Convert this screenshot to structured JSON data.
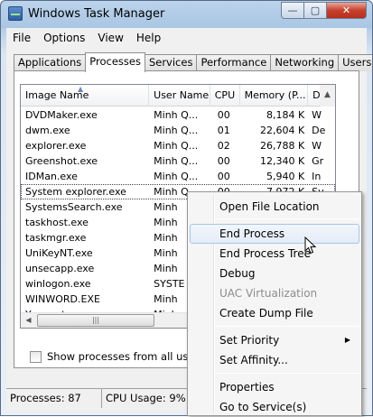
{
  "window": {
    "title": "Windows Task Manager",
    "min_label": "—",
    "max_label": "▢",
    "close_label": "✕"
  },
  "menu": [
    "File",
    "Options",
    "View",
    "Help"
  ],
  "tabs": [
    "Applications",
    "Processes",
    "Services",
    "Performance",
    "Networking",
    "Users"
  ],
  "active_tab": "Processes",
  "columns": [
    "Image Name",
    "User Name",
    "CPU",
    "Memory (P...",
    "De"
  ],
  "sort_arrow": "▲",
  "processes": [
    {
      "name": "DVDMaker.exe",
      "user": "Minh Q...",
      "cpu": "00",
      "mem": "8,184 K",
      "desc": "W"
    },
    {
      "name": "dwm.exe",
      "user": "Minh Q...",
      "cpu": "01",
      "mem": "22,604 K",
      "desc": "De"
    },
    {
      "name": "explorer.exe",
      "user": "Minh Q...",
      "cpu": "02",
      "mem": "26,788 K",
      "desc": "W"
    },
    {
      "name": "Greenshot.exe",
      "user": "Minh Q...",
      "cpu": "00",
      "mem": "12,340 K",
      "desc": "Gr"
    },
    {
      "name": "IDMan.exe",
      "user": "Minh Q...",
      "cpu": "00",
      "mem": "5,940 K",
      "desc": "In"
    },
    {
      "name": "System explorer.exe",
      "user": "Minh Q...",
      "cpu": "00",
      "mem": "7,972 K",
      "desc": "Sy"
    },
    {
      "name": "SystemsSearch.exe",
      "user": "Minh",
      "cpu": "",
      "mem": "",
      "desc": ""
    },
    {
      "name": "taskhost.exe",
      "user": "Minh",
      "cpu": "",
      "mem": "",
      "desc": ""
    },
    {
      "name": "taskmgr.exe",
      "user": "Minh",
      "cpu": "",
      "mem": "",
      "desc": ""
    },
    {
      "name": "UniKeyNT.exe",
      "user": "Minh",
      "cpu": "",
      "mem": "",
      "desc": ""
    },
    {
      "name": "unsecapp.exe",
      "user": "Minh",
      "cpu": "",
      "mem": "",
      "desc": ""
    },
    {
      "name": "winlogon.exe",
      "user": "SYSTE",
      "cpu": "",
      "mem": "",
      "desc": ""
    },
    {
      "name": "WINWORD.EXE",
      "user": "Minh",
      "cpu": "",
      "mem": "",
      "desc": ""
    },
    {
      "name": "Ymsgr_tray.exe",
      "user": "Minh",
      "cpu": "",
      "mem": "",
      "desc": ""
    }
  ],
  "selected_process": "System explorer.exe",
  "scroll": {
    "left_arrow": "◀",
    "thumb_grip": "|||",
    "up_arrow": "▲"
  },
  "show_all_label": "Show processes from all users",
  "status": {
    "processes": "Processes: 87",
    "cpu": "CPU Usage: 9%"
  },
  "context_menu": {
    "items": [
      {
        "label": "Open File Location"
      },
      {
        "label": "End Process"
      },
      {
        "label": "End Process Tree"
      },
      {
        "label": "Debug"
      },
      {
        "label": "UAC Virtualization"
      },
      {
        "label": "Create Dump File"
      },
      {
        "label": "Set Priority"
      },
      {
        "label": "Set Affinity..."
      },
      {
        "label": "Properties"
      },
      {
        "label": "Go to Service(s)"
      }
    ],
    "hovered": "End Process",
    "disabled": [
      "UAC Virtualization"
    ],
    "submenu_arrow": "▶"
  }
}
